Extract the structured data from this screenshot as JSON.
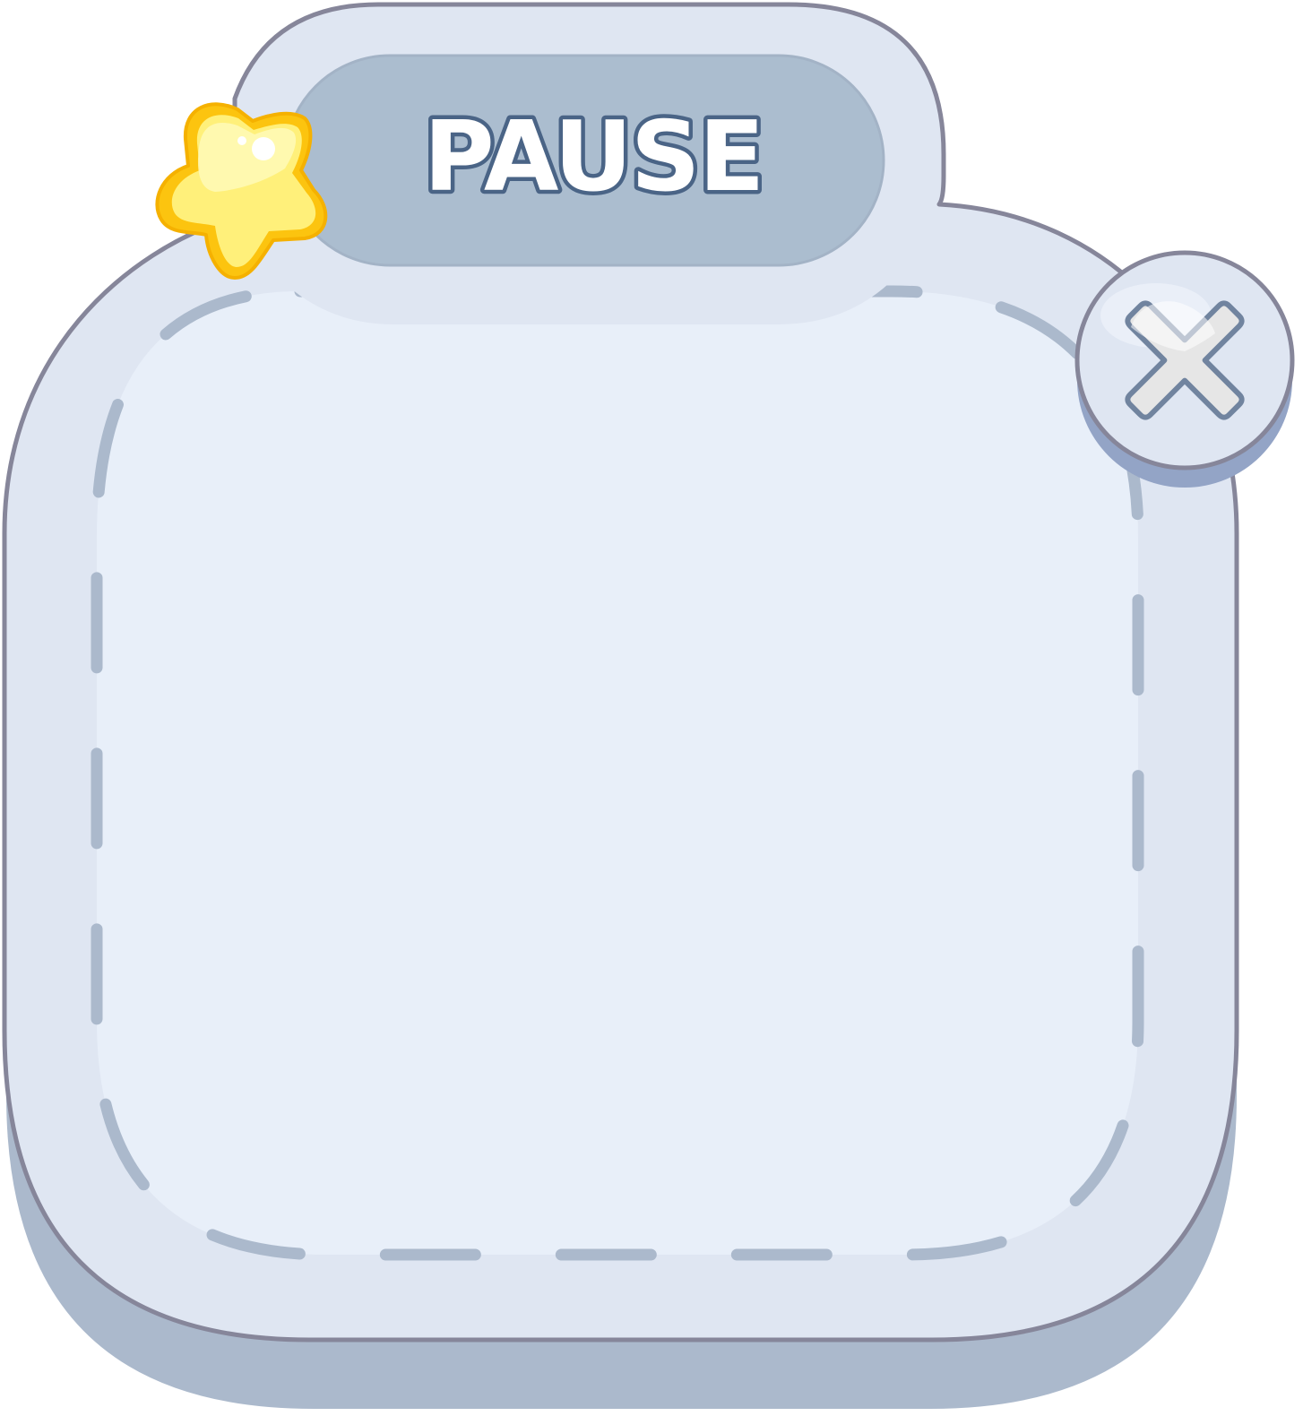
{
  "dialog": {
    "title": "PAUSE"
  },
  "icons": {
    "decoration": "star-icon",
    "close": "close-icon"
  },
  "colors": {
    "outline": "#86869a",
    "panel_fill": "#dfe6f2",
    "panel_shadow": "#abb9cc",
    "inner_fill": "#e8eff9",
    "dash": "#abb9cc",
    "title_pill": "#abbdcf",
    "title_text": "#ffffff",
    "title_stroke": "#4a6486",
    "star_fill": "#fff07a",
    "star_edge": "#fcc40f",
    "close_x": "#e6e6e6",
    "close_x_stroke": "#71849f"
  }
}
